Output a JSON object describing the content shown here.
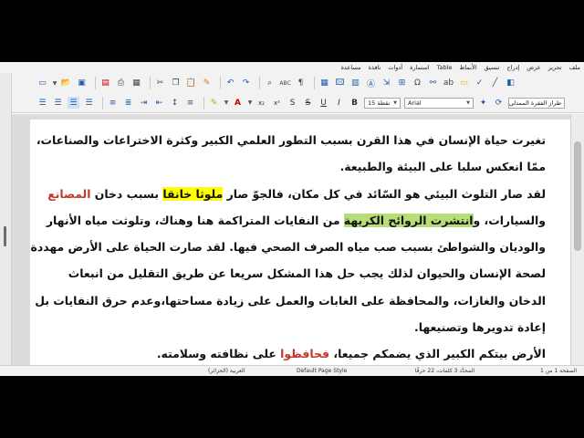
{
  "menubar": {
    "items": [
      "ملف",
      "تحرير",
      "عرض",
      "إدراج",
      "تنسيق",
      "الأنماط",
      "Table",
      "استمارة",
      "أدوات",
      "نافذة",
      "مساعدة"
    ]
  },
  "toolbar": {
    "style_name": "طراز الفقرة الممدلي",
    "font_name": "Arial",
    "font_size": "نقطة 15"
  },
  "document": {
    "para1": "تغيرت حياة الإنسان في هذا القرن بسبب التطور العلمي الكبير وكثرة الاختراعات والصناعات، ممّا انعكس سلبا على البيئة والطبيعة.",
    "p2_a": "لقد صار التلوث البيئي هو السّائد في كل مكان، فالجوّ صار ",
    "p2_hl1": "ملوثا خانقا",
    "p2_b": " بسبب دخان ",
    "p2_red1": "المصانع",
    "p2_c": " والسيارات، و",
    "p2_hl2": "انتشرت الروائح الكريهة",
    "p2_d": " من النفايات المتراكمة هنا وهناك، وتلوثت مياه الأنهار والوديان والشواطئ بسبب صب مياه الصرف الصحي فيها. لقد صارت الحياة على الأرض مهددة لصحة الإنسان والحيوان لذلك يجب حل هذا المشكل سريعا عن طريق التقليل من انبعاث الدخان والغازات، والمحافظة على الغابات والعمل على زيادة مساحتها،وعدم حرق النفايات بل إعادة تدويرها وتصنيعها.",
    "p3_a": "الأرض بيتكم الكبير الذي يضمكم جميعا، ",
    "p3_red": "فحافظوا",
    "p3_b": " على نظافته وسلامته."
  },
  "statusbar": {
    "page": "الصفحة 1 من 1",
    "words": "المحدَّد 3 كلمات، 22 حرفًا",
    "page_style": "Default Page Style",
    "language": "العربية (الجزائر)"
  },
  "colors": {
    "highlight_yellow": "#ffff00",
    "highlight_green": "#b8dc78",
    "red_text": "#c0392b"
  }
}
